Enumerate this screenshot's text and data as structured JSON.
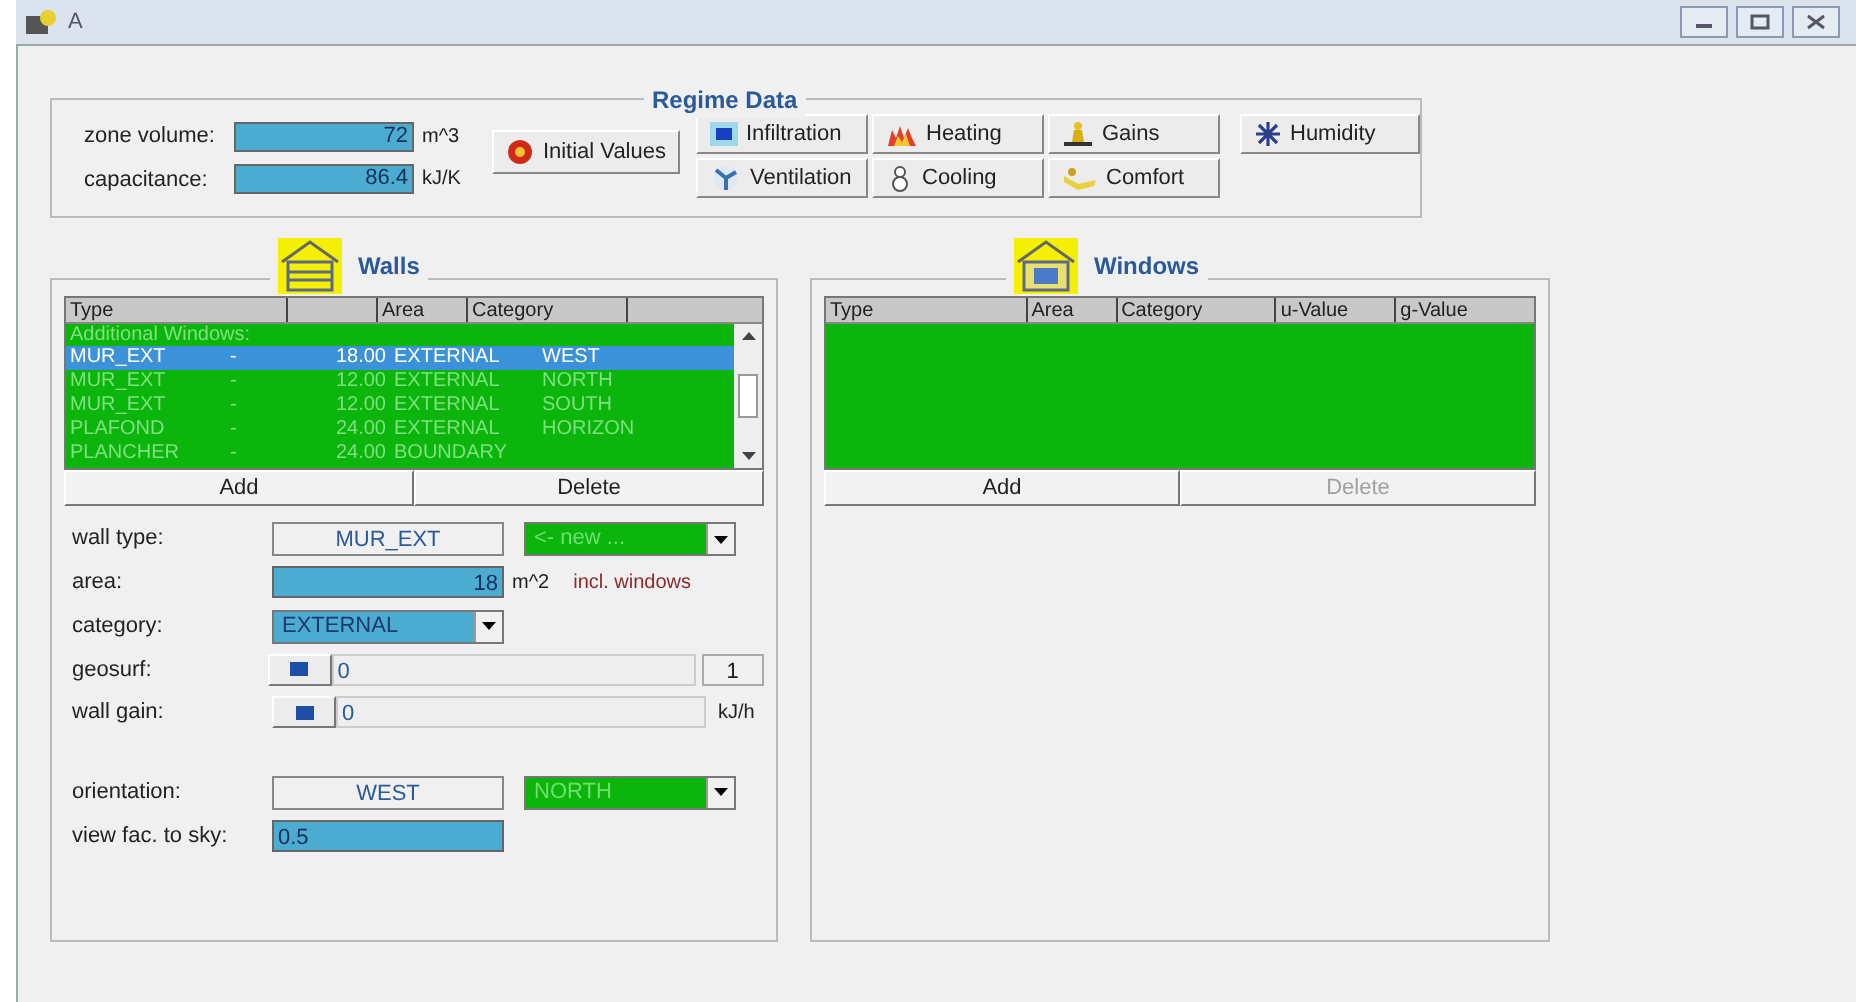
{
  "window": {
    "title": "A"
  },
  "regime": {
    "title": "Regime Data",
    "fields": [
      {
        "label": "zone volume:",
        "value": "72",
        "unit": "m^3"
      },
      {
        "label": "capacitance:",
        "value": "86.4",
        "unit": "kJ/K"
      }
    ],
    "initial_button": "Initial Values",
    "buttons": [
      [
        {
          "label": "Infiltration",
          "kind": "infiltration"
        },
        {
          "label": "Heating",
          "kind": "heating"
        },
        {
          "label": "Gains",
          "kind": "gains"
        },
        {
          "label": "Humidity",
          "kind": "humidity"
        }
      ],
      [
        {
          "label": "Ventilation",
          "kind": "ventilation"
        },
        {
          "label": "Cooling",
          "kind": "cooling"
        },
        {
          "label": "Comfort",
          "kind": "comfort"
        }
      ]
    ]
  },
  "walls": {
    "title": "Walls",
    "columns": [
      "Type",
      "",
      "Area",
      "Category",
      ""
    ],
    "rows": [
      {
        "kind": "group",
        "label": "Additional Windows:"
      },
      {
        "kind": "item",
        "selected": true,
        "cells": [
          "MUR_EXT",
          "-",
          "18.00",
          "EXTERNAL",
          "WEST"
        ]
      },
      {
        "kind": "item",
        "selected": false,
        "cells": [
          "MUR_EXT",
          "-",
          "12.00",
          "EXTERNAL",
          "NORTH"
        ]
      },
      {
        "kind": "item",
        "selected": false,
        "cells": [
          "MUR_EXT",
          "-",
          "12.00",
          "EXTERNAL",
          "SOUTH"
        ]
      },
      {
        "kind": "item",
        "selected": false,
        "cells": [
          "PLAFOND",
          "-",
          "24.00",
          "EXTERNAL",
          "HORIZON"
        ]
      },
      {
        "kind": "item",
        "selected": false,
        "cells": [
          "PLANCHER",
          "-",
          "24.00",
          "BOUNDARY",
          ""
        ]
      }
    ],
    "add": {
      "label": "Add",
      "disabled": false
    },
    "delete": {
      "label": "Delete",
      "disabled": false
    },
    "wall_type": {
      "label": "wall type:",
      "value": "MUR_EXT",
      "select": "<- new ..."
    },
    "area": {
      "label": "area:",
      "value": "18",
      "unit": "m^2",
      "note": "incl. windows"
    },
    "category": {
      "label": "category:",
      "value": "EXTERNAL"
    },
    "geosurf": {
      "label": "geosurf:",
      "value": "0",
      "factor": "1"
    },
    "wall_gain": {
      "label": "wall gain:",
      "value": "0",
      "unit": "kJ/h"
    },
    "orientation": {
      "label": "orientation:",
      "value": "WEST",
      "select": "NORTH"
    },
    "view_factor": {
      "label": "view fac. to sky:",
      "value": "0.5"
    }
  },
  "windows": {
    "title": "Windows",
    "columns": [
      "Type",
      "Area",
      "Category",
      "u-Value",
      "g-Value"
    ],
    "add": {
      "label": "Add",
      "disabled": false
    },
    "delete": {
      "label": "Delete",
      "disabled": true
    }
  }
}
